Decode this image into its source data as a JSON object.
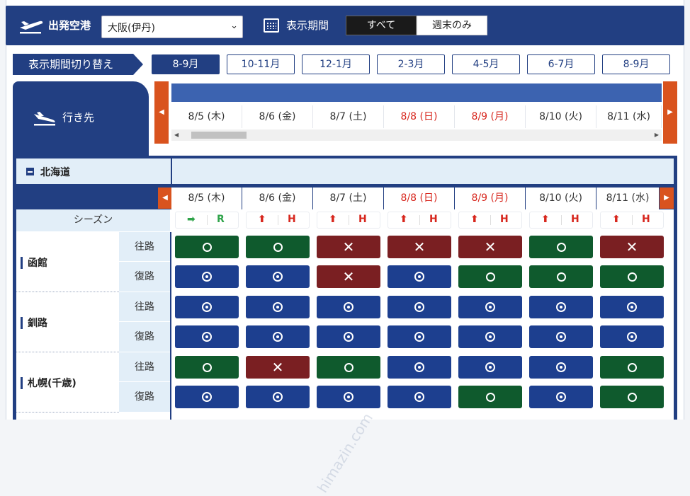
{
  "topbar": {
    "departure_label": "出発空港",
    "departure_value": "大阪(伊丹)",
    "period_label": "表示期間",
    "seg_all": "すべて",
    "seg_weekend": "週末のみ"
  },
  "period_switch": {
    "label": "表示期間切り替え",
    "buttons": [
      "8-9月",
      "10-11月",
      "12-1月",
      "2-3月",
      "4-5月",
      "6-7月",
      "8-9月"
    ],
    "active_index": 0
  },
  "dest_header": "行き先",
  "dates": [
    {
      "label": "8/5 (木)",
      "holiday": false
    },
    {
      "label": "8/6 (金)",
      "holiday": false
    },
    {
      "label": "8/7 (土)",
      "holiday": false
    },
    {
      "label": "8/8 (日)",
      "holiday": true
    },
    {
      "label": "8/9 (月)",
      "holiday": true
    },
    {
      "label": "8/10 (火)",
      "holiday": false
    },
    {
      "label": "8/11 (水)",
      "holiday": false
    }
  ],
  "region": {
    "name": "北海道"
  },
  "season_label": "シーズン",
  "season": [
    {
      "a": "➡",
      "b": "R",
      "color": "green"
    },
    {
      "a": "⬆",
      "b": "H",
      "color": "red"
    },
    {
      "a": "⬆",
      "b": "H",
      "color": "red"
    },
    {
      "a": "⬆",
      "b": "H",
      "color": "red"
    },
    {
      "a": "⬆",
      "b": "H",
      "color": "red"
    },
    {
      "a": "⬆",
      "b": "H",
      "color": "red"
    },
    {
      "a": "⬆",
      "b": "H",
      "color": "red"
    }
  ],
  "dir_out": "往路",
  "dir_ret": "復路",
  "cities": [
    {
      "name": "函館",
      "out": [
        "ring-green",
        "ring-green",
        "x-red",
        "x-red",
        "x-red",
        "ring-green",
        "x-red"
      ],
      "ret": [
        "dot-blue",
        "dot-blue",
        "x-red",
        "dot-blue",
        "ring-green",
        "ring-green",
        "ring-green"
      ]
    },
    {
      "name": "釧路",
      "out": [
        "dot-blue",
        "dot-blue",
        "dot-blue",
        "dot-blue",
        "dot-blue",
        "dot-blue",
        "dot-blue"
      ],
      "ret": [
        "dot-blue",
        "dot-blue",
        "dot-blue",
        "dot-blue",
        "dot-blue",
        "dot-blue",
        "dot-blue"
      ]
    },
    {
      "name": "札幌(千歳)",
      "out": [
        "ring-green",
        "x-red",
        "ring-green",
        "dot-blue",
        "dot-blue",
        "dot-blue",
        "ring-green"
      ],
      "ret": [
        "dot-blue",
        "dot-blue",
        "dot-blue",
        "dot-blue",
        "ring-green",
        "dot-blue",
        "ring-green"
      ]
    }
  ],
  "watermark": "himazin.com",
  "colors": {
    "navy": "#223f82",
    "green_cell": "#0f5a2d",
    "blue_cell": "#1d3f8f",
    "red_cell": "#7a1f22",
    "nav_orange": "#d9531e"
  }
}
